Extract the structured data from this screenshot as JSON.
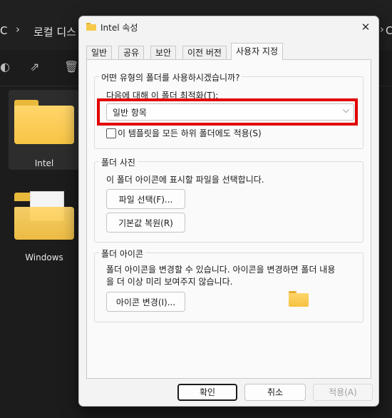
{
  "explorer": {
    "breadcrumb": {
      "prefix": "C",
      "crumb": "로컬 디스",
      "trailing": "C"
    },
    "items": [
      {
        "label": "Intel"
      },
      {
        "label": "Windows"
      }
    ]
  },
  "dialog": {
    "title": "Intel 속성",
    "close_label": "✕",
    "tabs": [
      {
        "label": "일반"
      },
      {
        "label": "공유"
      },
      {
        "label": "보안"
      },
      {
        "label": "이전 버전"
      },
      {
        "label": "사용자 지정"
      }
    ],
    "optimize_group": {
      "title": "어떤 유형의 폴더를 사용하시겠습니까?",
      "optimize_label": "다음에 대해 이 폴더 최적화(T):",
      "selected_option": "일반 항목",
      "checkbox_label": "이 템플릿을 모든 하위 폴더에도 적용(S)",
      "checkbox_checked": false
    },
    "folder_picture_group": {
      "title": "폴더 사진",
      "description": "이 폴더 아이콘에 표시할 파일을 선택합니다.",
      "choose_file_button": "파일 선택(F)...",
      "restore_default_button": "기본값 복원(R)"
    },
    "folder_icon_group": {
      "title": "폴더 아이콘",
      "description_line1": "폴더 아이콘을 변경할 수 있습니다. 아이콘을 변경하면 폴더 내용",
      "description_line2": "을 더 이상  미리 보여주지 않습니다.",
      "change_icon_button": "아이콘 변경(I)..."
    },
    "footer": {
      "ok_button": "확인",
      "cancel_button": "취소",
      "apply_button": "적용(A)"
    }
  }
}
